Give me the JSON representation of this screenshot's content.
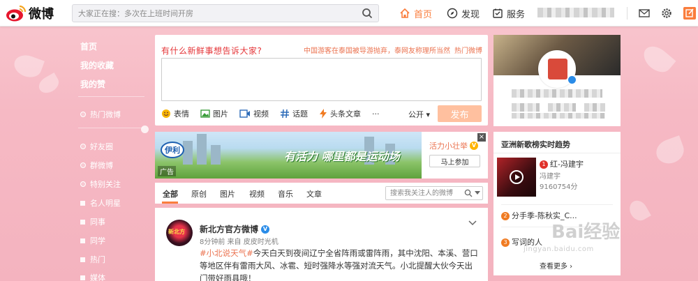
{
  "header": {
    "logo_text": "微博",
    "search_placeholder": "大家正在搜：多次在上班时间开房",
    "nav": [
      {
        "label": "首页",
        "icon": "home-icon"
      },
      {
        "label": "发现",
        "icon": "compass-icon"
      },
      {
        "label": "服务",
        "icon": "service-icon"
      }
    ]
  },
  "sidebar": {
    "main_items": [
      "首页",
      "我的收藏",
      "我的赞"
    ],
    "hot": "热门微博",
    "groups": [
      "好友圈",
      "群微博",
      "特别关注"
    ],
    "sub_items": [
      "名人明星",
      "同事",
      "同学",
      "热门",
      "媒体"
    ]
  },
  "publisher": {
    "prompt": "有什么新鲜事想告诉大家?",
    "hot_headline": "中国游客在泰国被导游抛弃，泰网友称理所当然",
    "hot_link": "热门微博",
    "tools": [
      "表情",
      "图片",
      "视频",
      "话题",
      "头条文章",
      "···"
    ],
    "visibility": "公开 ▾",
    "send_label": "发布"
  },
  "ad": {
    "logo": "伊利",
    "slogan": "有活力 哪里都是运动场",
    "tag": "广告",
    "brand": "活力小壮举",
    "follow_label": "马上参加",
    "close": "×"
  },
  "feed_tabs": {
    "tabs": [
      "全部",
      "原创",
      "图片",
      "视频",
      "音乐",
      "文章"
    ],
    "search_placeholder": "搜索我关注人的微博"
  },
  "post": {
    "author": "新北方官方微博",
    "meta": "8分钟前 来自 皮皮时光机",
    "tag": "#小北说天气#",
    "body": "今天白天到夜间辽宁全省阵雨或雷阵雨，其中沈阳、本溪、营口等地区伴有雷雨大风、冰雹、短时强降水等强对流天气。小北提醒大伙今天出门带好雨具哦！",
    "avatar_text": "新北方"
  },
  "trend": {
    "title": "亚洲新歌榜实时趋势",
    "top": {
      "rank": "1",
      "title": "红-冯建宇",
      "artist": "冯建宇",
      "count": "9160754分"
    },
    "items": [
      {
        "rank": "2",
        "title": "分手季-陈秋实_C..."
      },
      {
        "rank": "3",
        "title": "写词的人"
      }
    ],
    "more": "查看更多 ›"
  },
  "watermark": {
    "text": "Bai经验",
    "sub": "jingyan.baidu.com"
  }
}
